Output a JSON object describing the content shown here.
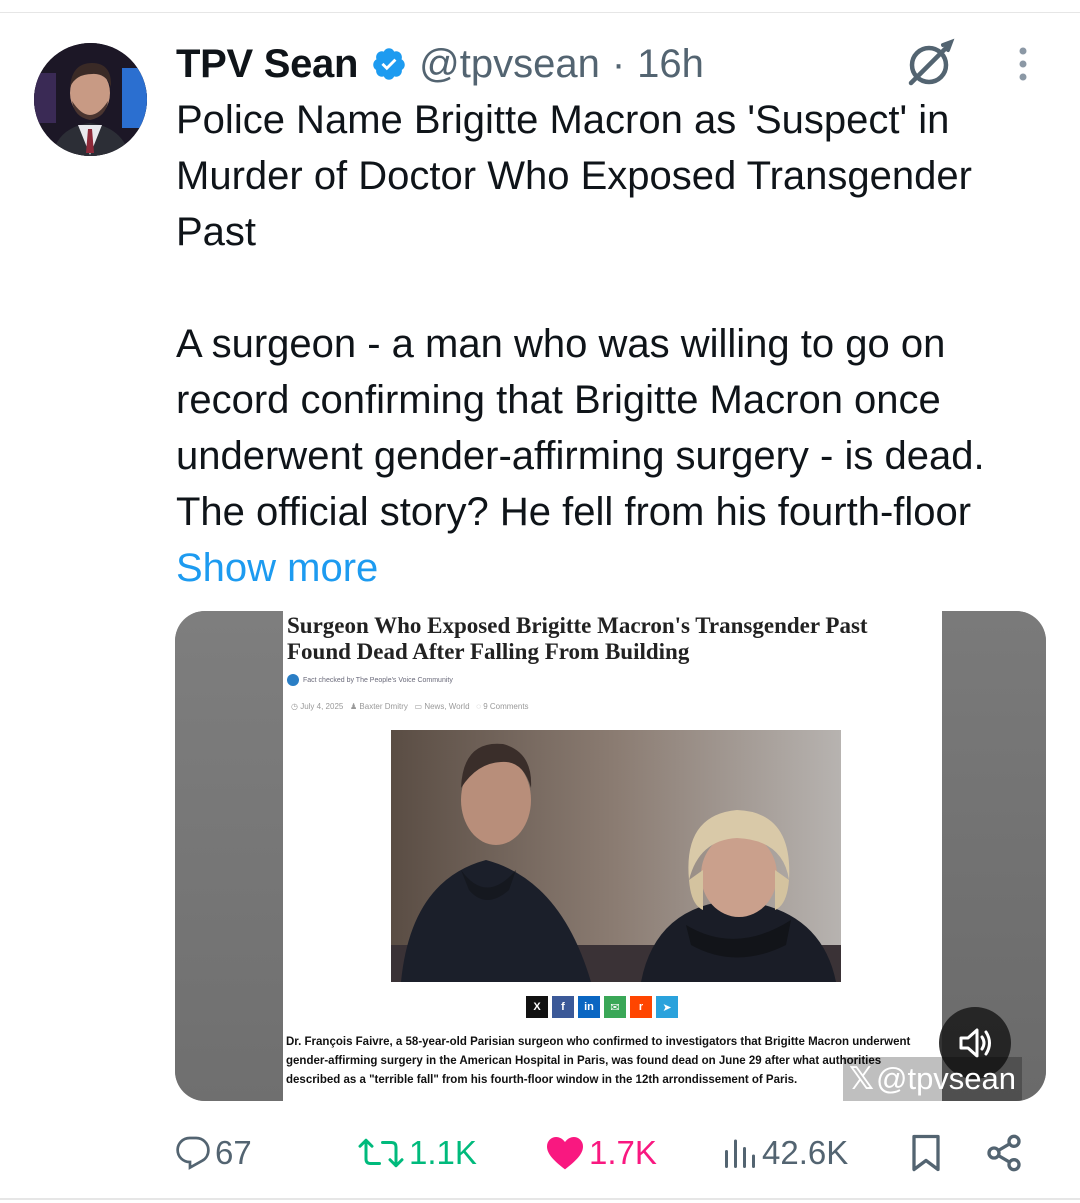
{
  "tweet": {
    "author_name": "TPV Sean",
    "handle": "@tpvsean",
    "separator": "·",
    "time": "16h",
    "text": "Police Name Brigitte Macron as 'Suspect' in Murder of Doctor Who Exposed Transgender Past\n\nA surgeon - a man who was willing to go on record confirming that Brigitte Macron once underwent gender-affirming surgery - is dead. The official story? He fell from his fourth-floor ",
    "show_more": "Show more"
  },
  "media": {
    "article_title": "Surgeon Who Exposed Brigitte Macron's Transgender Past Found Dead After Falling From Building",
    "fact_check": "Fact checked by The People's Voice Community",
    "date": "July 4, 2025",
    "author": "Baxter Dmitry",
    "category": "News, World",
    "comments": "9 Comments",
    "share_buttons": [
      "X",
      "f",
      "in",
      "✉",
      "r",
      "➤"
    ],
    "share_colors": [
      "#111111",
      "#3b5998",
      "#0a66c2",
      "#3aa757",
      "#ff4500",
      "#2aa2dc"
    ],
    "body": "Dr. François Faivre, a 58-year-old Parisian surgeon who confirmed to investigators that Brigitte Macron underwent gender-affirming surgery in the American Hospital in Paris, was found dead on June 29 after what authorities described as a \"terrible fall\" from his fourth-floor window in the 12th arrondissement of Paris.",
    "watermark": "@tpvsean"
  },
  "actions": {
    "replies": "67",
    "reposts": "1.1K",
    "likes": "1.7K",
    "views": "42.6K"
  },
  "colors": {
    "verified": "#1d9bf0",
    "link": "#1d9bf0",
    "repost": "#00ba7c",
    "like": "#f91880",
    "muted": "#536471"
  }
}
